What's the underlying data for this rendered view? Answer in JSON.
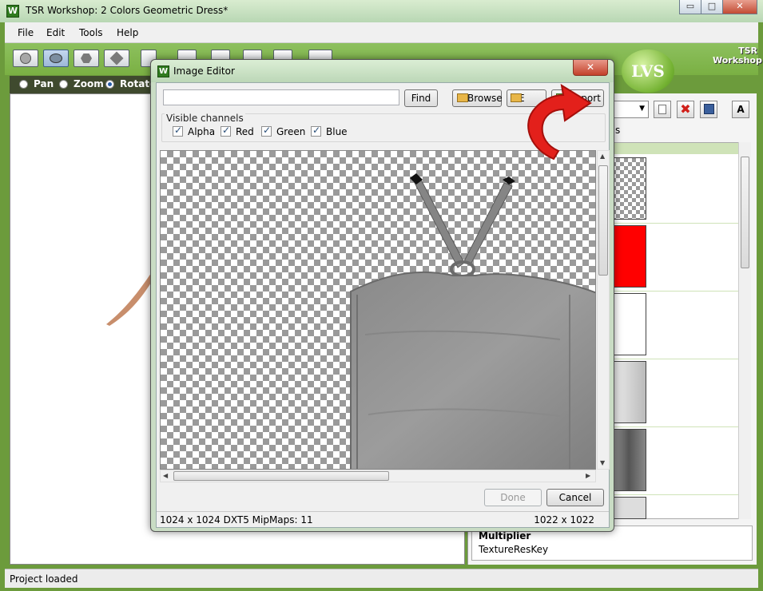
{
  "window": {
    "title": "TSR Workshop: 2 Colors Geometric Dress*",
    "app_icon_letter": "W",
    "minimize_glyph": "▭",
    "maximize_glyph": "□",
    "close_glyph": "✕"
  },
  "menu": {
    "items": [
      "File",
      "Edit",
      "Tools",
      "Help"
    ]
  },
  "viewbar": {
    "modes": [
      "Pan",
      "Zoom",
      "Rotate"
    ],
    "selected": "Rotate"
  },
  "logos": {
    "lvs": "LVS",
    "tsr_line1": "TSR",
    "tsr_line2": "Workshop"
  },
  "right_panel": {
    "partial_label": "s",
    "text_button": "A",
    "bottom_title": "Multiplier",
    "bottom_sub": "TextureResKey"
  },
  "status": {
    "text": "Project loaded"
  },
  "dialog": {
    "title": "Image Editor",
    "app_icon_letter": "W",
    "close_glyph": "✕",
    "search_value": "",
    "find_label": "Find",
    "browse_label": "Browse",
    "export_label_partial": "E",
    "import_label": "Import",
    "channels_legend": "Visible channels",
    "channels": [
      {
        "label": "Alpha",
        "checked": true
      },
      {
        "label": "Red",
        "checked": true
      },
      {
        "label": "Green",
        "checked": true
      },
      {
        "label": "Blue",
        "checked": true
      }
    ],
    "done_label": "Done",
    "cancel_label": "Cancel",
    "status_left": "1024 x 1024 DXT5 MipMaps: 11",
    "status_right": "1022 x 1022"
  },
  "colors": {
    "accent_green": "#7ab043",
    "arrow_red": "#e3201b",
    "thumb_red": "#ff0000"
  }
}
